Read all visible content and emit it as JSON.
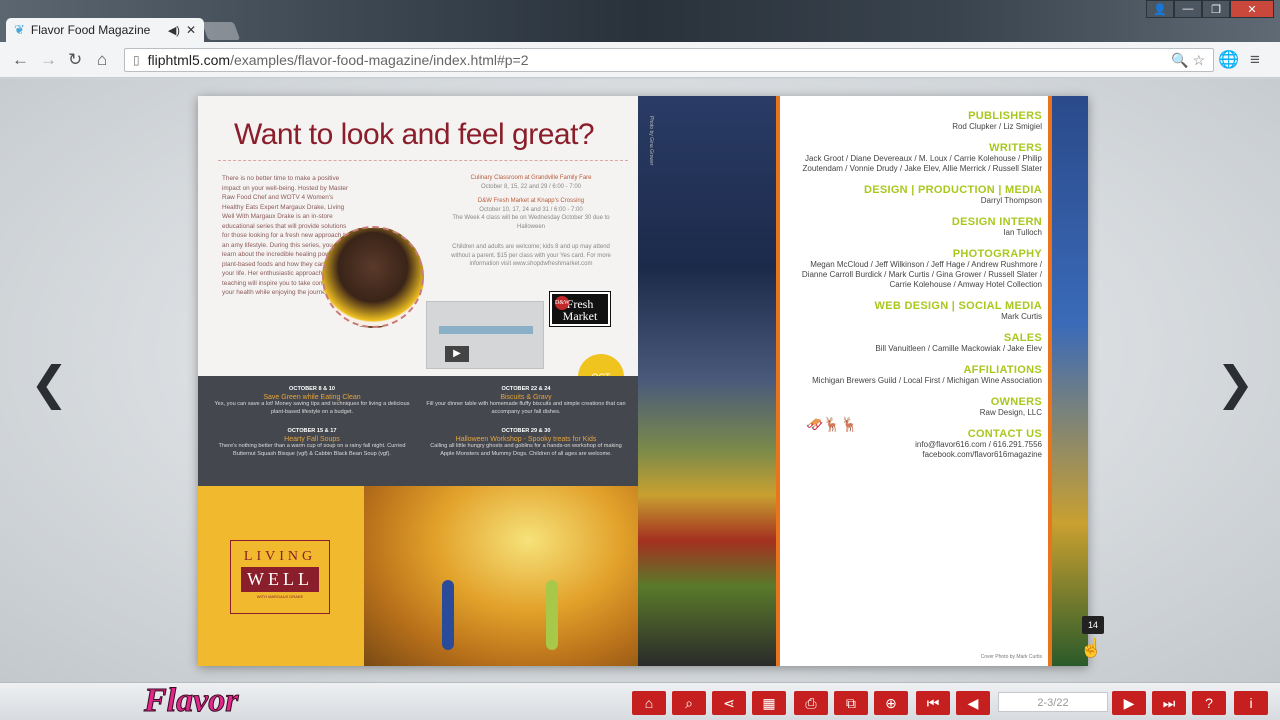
{
  "browser": {
    "tab_title": "Flavor Food Magazine",
    "tab_close": "✕",
    "url_domain": "fliphtml5.com",
    "url_path": "/examples/flavor-food-magazine/index.html#p=2",
    "window_controls": [
      "—",
      "❐",
      "✕"
    ]
  },
  "left_page": {
    "headline": "Want to look and feel great?",
    "intro": "There is no better time to make a positive impact on your well-being. Hosted by Master Raw Food Chef and WOTV 4 Women's Healthy Eats Expert Margaux Drake, Living Well With Margaux Drake is an in-store educational series that will provide solutions for those looking for a fresh new approach to an amy lifestyle. During this series, you will learn about the incredible healing power of plant-based foods and how they can change your life. Her enthusiastic approach to teaching will inspire you to take control of your health while enjoying the journey.",
    "venue1": "Culinary Classroom at Grandville Family Fare",
    "venue1_dates": "October 8, 15, 22 and 29 / 6:00 - 7:00",
    "venue2": "D&W Fresh Market at Knapp's Crossing",
    "venue2_dates": "October 10, 17, 24 and 31 / 6:00 - 7:00",
    "venue2_note": "The Week 4 class will be on Wednesday October 30 due to Halloween",
    "note": "Children and adults are welcome; kids 8 and up may attend without a parent. $15 per class with your Yes card. For more information visit www.shopdwfreshmarket.com",
    "badge_text": "Fresh Market",
    "badge_logo": "D&W",
    "oct_label": "OCT",
    "events": [
      {
        "date": "OCTOBER 8 & 10",
        "title": "Save Green while Eating Clean",
        "desc": "Yes, you can save a lot! Money saving tips and techniques for living a delicious plant-based lifestyle on a budget."
      },
      {
        "date": "OCTOBER 22 & 24",
        "title": "Biscuits & Gravy",
        "desc": "Fill your dinner table with homemade fluffy biscuits and simple creations that can accompany your fall dishes."
      },
      {
        "date": "OCTOBER 15 & 17",
        "title": "Hearty Fall Soups",
        "desc": "There's nothing better than a warm cup of soup on a rainy fall night. Curried Butternut Squash Bisque (vgf) & Cabbin Black Bean Soup (vgf)."
      },
      {
        "date": "OCTOBER 29 & 30",
        "title": "Halloween Workshop - Spooky treats for Kids",
        "desc": "Calling all little hungry ghosts and goblins for a hands-on workshop of making Apple Monsters and Mummy Dogs. Children of all ages are welcome."
      }
    ],
    "living": "LIVING",
    "well": "WELL",
    "living_sub": "WITH MARGAUX DRAKE"
  },
  "masthead": [
    {
      "heading": "PUBLISHERS",
      "names": "Rod Clupker / Liz Smigiel"
    },
    {
      "heading": "WRITERS",
      "names": "Jack Groot / Diane Devereaux / M. Loux / Carrie Kolehouse / Philip Zoutendam / Vonnie Drudy / Jake Elev, Allie Merrick / Russell Slater"
    },
    {
      "heading": "DESIGN | PRODUCTION | MEDIA",
      "names": "Darryl Thompson"
    },
    {
      "heading": "DESIGN INTERN",
      "names": "Ian Tulloch"
    },
    {
      "heading": "PHOTOGRAPHY",
      "names": "Megan McCloud / Jeff Wilkinson / Jeff Hage / Andrew Rushmore / Dianne Carroll Burdick / Mark Curtis / Gina Grower / Russell Slater / Carrie Kolehouse / Amway Hotel Collection"
    },
    {
      "heading": "WEB DESIGN | SOCIAL MEDIA",
      "names": "Mark Curtis"
    },
    {
      "heading": "SALES",
      "names": "Bill Vanuitleen / Camille Mackowiak / Jake Elev"
    },
    {
      "heading": "AFFILIATIONS",
      "names": "Michigan Brewers Guild / Local First / Michigan Wine Association"
    },
    {
      "heading": "OWNERS",
      "names": "Raw Design, LLC"
    },
    {
      "heading": "CONTACT US",
      "names": "info@flavor616.com / 616.291.7556 facebook.com/flavor616magazine"
    }
  ],
  "candy_caption": "Photo by Gina Grower",
  "cover_credit": "Cover Photo by Mark Curtis",
  "page_badge": "14",
  "viewer": {
    "prev_arrow": "❮",
    "next_arrow": "❯",
    "logo": "Flavor",
    "page_indicator": "2-3/22"
  },
  "toolbar_icons": [
    "home-icon",
    "search-icon",
    "share-icon",
    "thumbnails-icon",
    "print-icon",
    "fullscreen-icon",
    "zoom-in-icon",
    "first-page-icon",
    "prev-page-icon",
    "next-page-icon",
    "last-page-icon",
    "help-icon",
    "info-icon"
  ],
  "colors": {
    "accent": "#c61f1f",
    "masthead_green": "#a8c81e",
    "headline": "#8a1e2a",
    "logo_pink": "#e0288a"
  }
}
